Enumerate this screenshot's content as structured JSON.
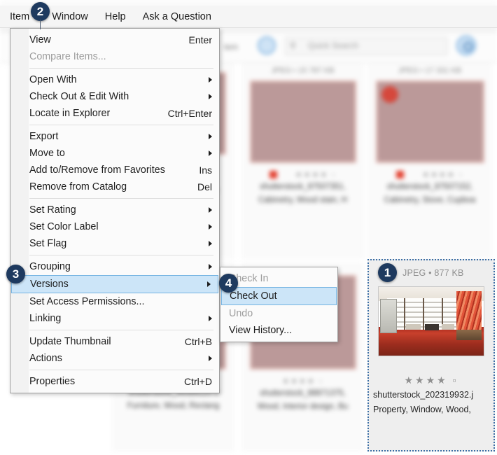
{
  "app": {
    "toolbar": {
      "search_placeholder": "Quick Search",
      "search_icon": "search-icon",
      "refresh_icon": "refresh-icon",
      "go_icon": "search-go-icon",
      "left_label": "tem"
    }
  },
  "menubar": {
    "items": [
      {
        "label": "Item",
        "active": true
      },
      {
        "label": "Window",
        "active": false
      },
      {
        "label": "Help",
        "active": false
      },
      {
        "label": "Ask a Question",
        "active": false
      }
    ]
  },
  "item_menu": {
    "rows": [
      {
        "label": "View",
        "accel": "Enter",
        "arrow": false,
        "disabled": false,
        "highlight": false
      },
      {
        "label": "Compare Items...",
        "accel": "",
        "arrow": false,
        "disabled": true,
        "highlight": false
      },
      {
        "sep": true
      },
      {
        "label": "Open With",
        "accel": "",
        "arrow": true,
        "disabled": false,
        "highlight": false
      },
      {
        "label": "Check Out & Edit With",
        "accel": "",
        "arrow": true,
        "disabled": false,
        "highlight": false
      },
      {
        "label": "Locate in Explorer",
        "accel": "Ctrl+Enter",
        "arrow": false,
        "disabled": false,
        "highlight": false
      },
      {
        "sep": true
      },
      {
        "label": "Export",
        "accel": "",
        "arrow": true,
        "disabled": false,
        "highlight": false
      },
      {
        "label": "Move to",
        "accel": "",
        "arrow": true,
        "disabled": false,
        "highlight": false
      },
      {
        "label": "Add to/Remove from Favorites",
        "accel": "Ins",
        "arrow": false,
        "disabled": false,
        "highlight": false
      },
      {
        "label": "Remove from Catalog",
        "accel": "Del",
        "arrow": false,
        "disabled": false,
        "highlight": false
      },
      {
        "sep": true
      },
      {
        "label": "Set Rating",
        "accel": "",
        "arrow": true,
        "disabled": false,
        "highlight": false
      },
      {
        "label": "Set Color Label",
        "accel": "",
        "arrow": true,
        "disabled": false,
        "highlight": false
      },
      {
        "label": "Set Flag",
        "accel": "",
        "arrow": true,
        "disabled": false,
        "highlight": false
      },
      {
        "sep": true
      },
      {
        "label": "Grouping",
        "accel": "",
        "arrow": true,
        "disabled": false,
        "highlight": false
      },
      {
        "label": "Versions",
        "accel": "",
        "arrow": true,
        "disabled": false,
        "highlight": true
      },
      {
        "label": "Set Access Permissions...",
        "accel": "",
        "arrow": false,
        "disabled": false,
        "highlight": false
      },
      {
        "label": "Linking",
        "accel": "",
        "arrow": true,
        "disabled": false,
        "highlight": false
      },
      {
        "sep": true
      },
      {
        "label": "Update Thumbnail",
        "accel": "Ctrl+B",
        "arrow": false,
        "disabled": false,
        "highlight": false
      },
      {
        "label": "Actions",
        "accel": "",
        "arrow": true,
        "disabled": false,
        "highlight": false
      },
      {
        "sep": true
      },
      {
        "label": "Properties",
        "accel": "Ctrl+D",
        "arrow": false,
        "disabled": false,
        "highlight": false
      }
    ]
  },
  "versions_submenu": {
    "rows": [
      {
        "label": "Check In",
        "accel": "",
        "arrow": false,
        "disabled": true,
        "highlight": false
      },
      {
        "label": "Check Out",
        "accel": "",
        "arrow": false,
        "disabled": false,
        "highlight": true
      },
      {
        "label": "Undo",
        "accel": "",
        "arrow": false,
        "disabled": true,
        "highlight": false
      },
      {
        "label": "View History...",
        "accel": "",
        "arrow": false,
        "disabled": false,
        "highlight": false
      }
    ]
  },
  "selected_item": {
    "format_size": "JPEG • 877 KB",
    "rating_stars": "★★★★ ▫",
    "filename": "shutterstock_202319932.j",
    "keywords": "Property, Window, Wood,"
  },
  "background_items": [
    {
      "format_size": "JPEG • 15 787 KB",
      "stars": "★★★★ ▫",
      "filename": "shutterstock_87507351,",
      "keywords": "Cabinetry, Wood stain, H"
    },
    {
      "format_size": "JPEG • 17 331 KB",
      "stars": "★★★★ ▫",
      "filename": "shutterstock_87507152,",
      "keywords": "Cabinetry, Stove, Cupboa"
    },
    {
      "format_size": "",
      "stars": "▫ ▫ ▫ ▫ ▫",
      "filename": "shutterstock_99389120 s",
      "keywords": "Furniture, Wood, Rectang"
    },
    {
      "format_size": "",
      "stars": "★★★★ ▫",
      "filename": "shutterstock_88871375,",
      "keywords": "Wood, Interior design, Bu"
    }
  ],
  "step_badges": {
    "one": "1",
    "two": "2",
    "three": "3",
    "four": "4"
  },
  "colors": {
    "badge_bg": "#1e3a5f",
    "menu_highlight": "#cce5f8",
    "menu_highlight_border": "#76b4e2",
    "color_label_red": "#e23c2b",
    "selection_border": "#3b6ea5"
  }
}
